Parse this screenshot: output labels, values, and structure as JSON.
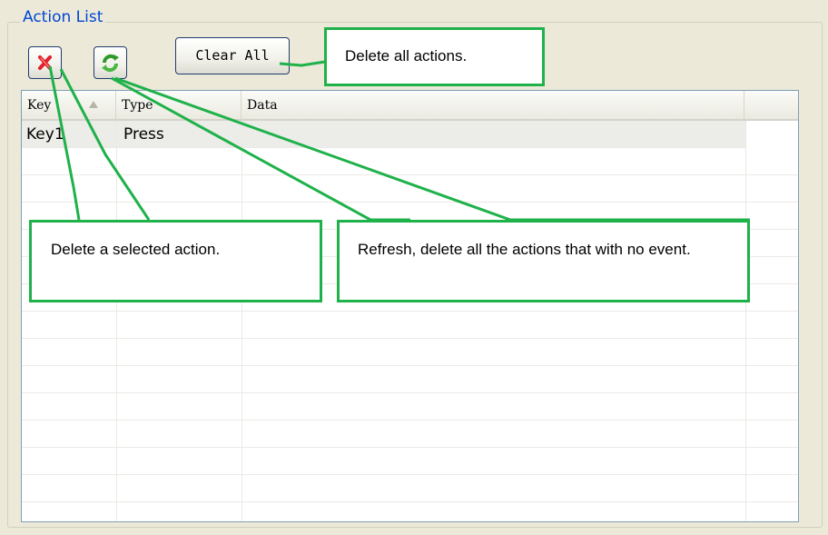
{
  "group": {
    "title": "Action List"
  },
  "toolbar": {
    "delete_icon": "delete-x-icon",
    "refresh_icon": "refresh-arrows-icon",
    "clear_all_label": "Clear All"
  },
  "list": {
    "columns": [
      {
        "label": "Key",
        "sorted": "ascending"
      },
      {
        "label": "Type"
      },
      {
        "label": "Data"
      },
      {
        "label": ""
      }
    ],
    "rows": [
      {
        "key": "Key1",
        "type": "Press",
        "data": "",
        "selected": true
      }
    ]
  },
  "callouts": {
    "clear_all": "Delete all actions.",
    "delete": "Delete a selected action.",
    "refresh": "Refresh, delete all the actions that with no event."
  },
  "colors": {
    "callout_border": "#1fb14a",
    "group_title": "#0046d5",
    "delete_icon": "#e0202a",
    "refresh_icon": "#2f9a2a"
  }
}
